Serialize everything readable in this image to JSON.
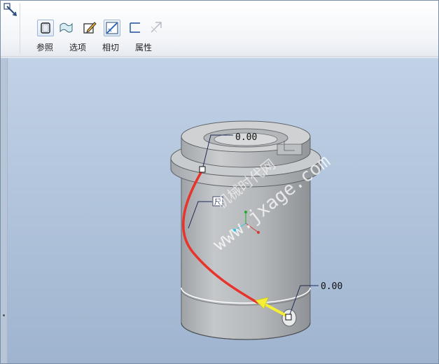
{
  "toolbar": {
    "tabs": [
      {
        "label": "参照",
        "icon": "reference-icon"
      },
      {
        "label": "选项",
        "icon": "options-icon"
      },
      {
        "label": "相切",
        "icon": "tangent-icon"
      },
      {
        "label": "属性",
        "icon": "properties-icon"
      }
    ]
  },
  "model": {
    "dim_top": "0.00",
    "dim_bottom": "0.00",
    "tag_label": "尺",
    "watermark": "www.jxage.com",
    "watermark_cn": "机械时代网"
  },
  "colors": {
    "curve": "#e8322a",
    "arrow": "#f4ee34",
    "body": "#b7babd",
    "viewport_top": "#c2d2e6",
    "viewport_bottom": "#9fb4cf"
  }
}
